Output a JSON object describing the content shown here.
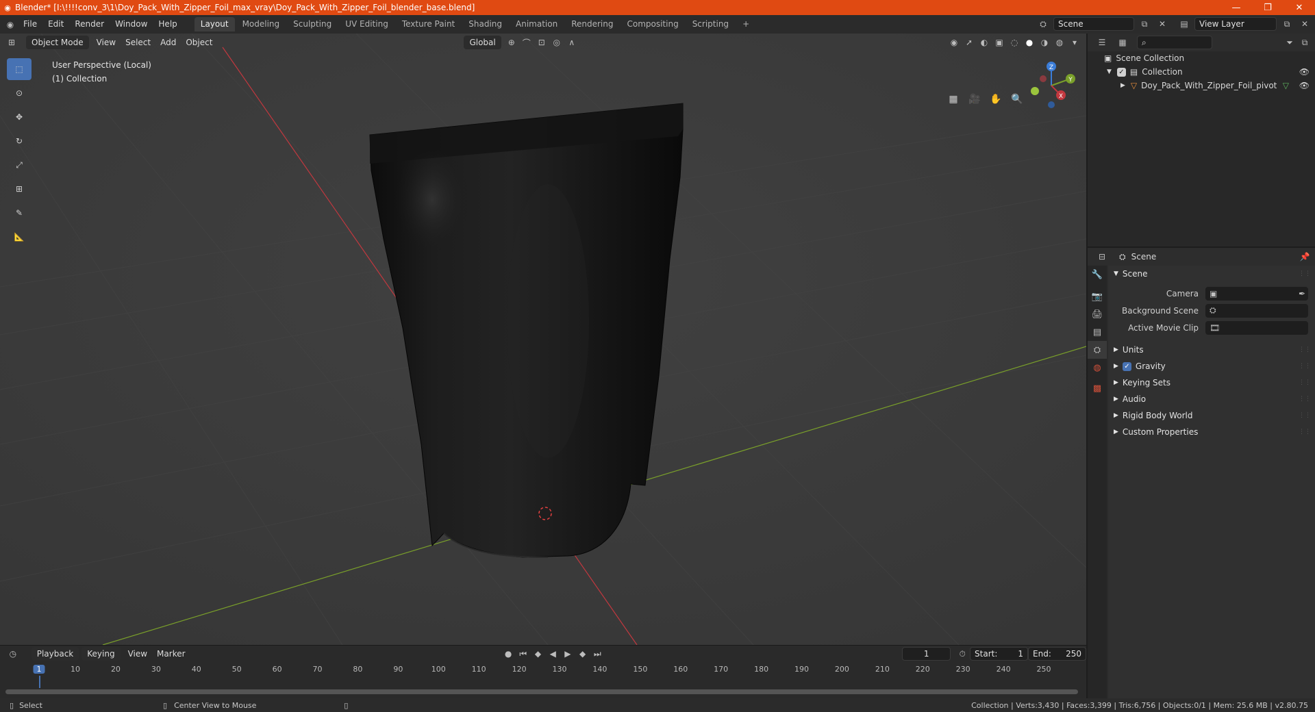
{
  "window": {
    "title": "Blender* [I:\\!!!!conv_3\\1\\Doy_Pack_With_Zipper_Foil_max_vray\\Doy_Pack_With_Zipper_Foil_blender_base.blend]",
    "minimize": "—",
    "maximize": "❐",
    "close": "✕"
  },
  "menu": [
    "File",
    "Edit",
    "Render",
    "Window",
    "Help"
  ],
  "workspaces": [
    "Layout",
    "Modeling",
    "Sculpting",
    "UV Editing",
    "Texture Paint",
    "Shading",
    "Animation",
    "Rendering",
    "Compositing",
    "Scripting"
  ],
  "add_workspace": "+",
  "scene_field": "Scene",
  "view_layer_field": "View Layer",
  "viewport": {
    "mode": "Object Mode",
    "menus": [
      "View",
      "Select",
      "Add",
      "Object"
    ],
    "transform_orientation": "Global",
    "info_line1": "User Perspective (Local)",
    "info_line2": "(1) Collection",
    "gizmo": {
      "z": "Z",
      "y": "Y",
      "x": "X"
    }
  },
  "outliner": {
    "root": "Scene Collection",
    "collection": "Collection",
    "object": "Doy_Pack_With_Zipper_Foil_pivot"
  },
  "properties": {
    "header": "Scene",
    "panel": "Scene",
    "camera_label": "Camera",
    "background_scene_label": "Background Scene",
    "active_movie_clip_label": "Active Movie Clip",
    "collapsed": [
      "Units",
      "Gravity",
      "Keying Sets",
      "Audio",
      "Rigid Body World",
      "Custom Properties"
    ],
    "gravity_checked": true
  },
  "timeline": {
    "menus": [
      "Playback",
      "Keying",
      "View",
      "Marker"
    ],
    "current_frame": "1",
    "start_label": "Start:",
    "start_value": "1",
    "end_label": "End:",
    "end_value": "250",
    "ruler": [
      "1",
      "10",
      "20",
      "30",
      "40",
      "50",
      "60",
      "70",
      "80",
      "90",
      "100",
      "110",
      "120",
      "130",
      "140",
      "150",
      "160",
      "170",
      "180",
      "190",
      "200",
      "210",
      "220",
      "230",
      "240",
      "250"
    ]
  },
  "statusbar": {
    "select": "Select",
    "center_view": "Center View to Mouse",
    "stats": "Collection | Verts:3,430 | Faces:3,399 | Tris:6,756 | Objects:0/1 | Mem: 25.6 MB | v2.80.75"
  },
  "colors": {
    "titlebar": "#e04a12",
    "accent": "#4772b3",
    "x_axis": "#c2383f",
    "y_axis": "#7aa02a"
  }
}
